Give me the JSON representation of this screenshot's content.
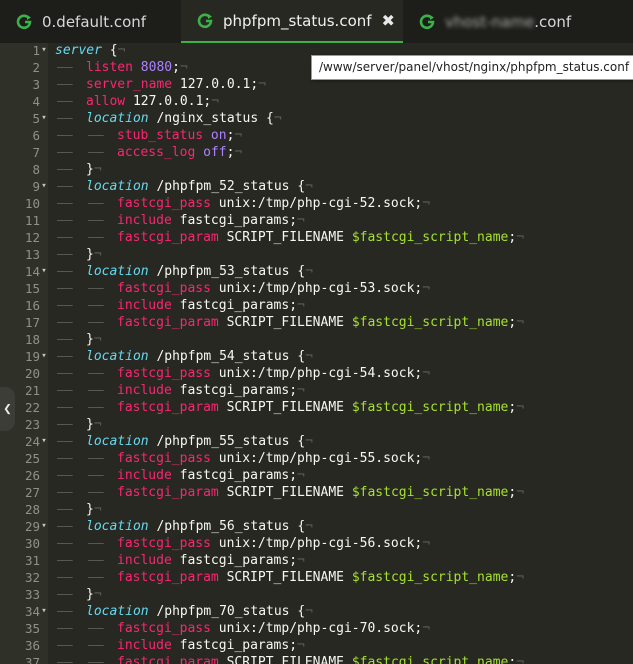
{
  "tabs": [
    {
      "label": "0.default.conf",
      "active": false,
      "icon": "refresh-g-icon"
    },
    {
      "label": "phpfpm_status.conf",
      "active": true,
      "icon": "refresh-g-icon",
      "close": "✖"
    },
    {
      "label_blurred": "vhost-name",
      "label_suffix": ".conf",
      "active": false,
      "icon": "refresh-g-icon"
    }
  ],
  "tooltip": "/www/server/panel/vhost/nginx/phpfpm_status.conf",
  "colors": {
    "bg": "#272822",
    "gutter": "#2f3129",
    "keyword": "#66d9ef",
    "directive": "#f92672",
    "number": "#ae81ff",
    "variable": "#a6e22e",
    "tab_accent": "#3bb14a"
  },
  "code": [
    {
      "n": "1",
      "fold": true,
      "seg": [
        [
          "k",
          "server"
        ],
        [
          "pl",
          " {"
        ]
      ]
    },
    {
      "n": "2",
      "ind": 1,
      "seg": [
        [
          "d",
          "listen"
        ],
        [
          "pl",
          " "
        ],
        [
          "n",
          "8080"
        ],
        [
          "pl",
          ";"
        ]
      ]
    },
    {
      "n": "3",
      "ind": 1,
      "seg": [
        [
          "d",
          "server_name"
        ],
        [
          "pl",
          " 127.0.0.1;"
        ]
      ]
    },
    {
      "n": "4",
      "ind": 1,
      "seg": [
        [
          "d",
          "allow"
        ],
        [
          "pl",
          " 127.0.0.1;"
        ]
      ]
    },
    {
      "n": "5",
      "ind": 1,
      "fold": true,
      "seg": [
        [
          "k",
          "location"
        ],
        [
          "pl",
          " /nginx_status {"
        ]
      ]
    },
    {
      "n": "6",
      "ind": 2,
      "seg": [
        [
          "d",
          "stub_status"
        ],
        [
          "pl",
          " "
        ],
        [
          "n",
          "on"
        ],
        [
          "pl",
          ";"
        ]
      ]
    },
    {
      "n": "7",
      "ind": 2,
      "seg": [
        [
          "d",
          "access_log"
        ],
        [
          "pl",
          " "
        ],
        [
          "n",
          "off"
        ],
        [
          "pl",
          ";"
        ]
      ]
    },
    {
      "n": "8",
      "ind": 1,
      "seg": [
        [
          "pl",
          "}"
        ]
      ]
    },
    {
      "n": "9",
      "ind": 1,
      "fold": true,
      "seg": [
        [
          "k",
          "location"
        ],
        [
          "pl",
          " /phpfpm_52_status {"
        ]
      ]
    },
    {
      "n": "10",
      "ind": 2,
      "seg": [
        [
          "d",
          "fastcgi_pass"
        ],
        [
          "pl",
          " unix:/tmp/php-cgi-52.sock;"
        ]
      ]
    },
    {
      "n": "11",
      "ind": 2,
      "seg": [
        [
          "d",
          "include"
        ],
        [
          "pl",
          " fastcgi_params;"
        ]
      ]
    },
    {
      "n": "12",
      "ind": 2,
      "seg": [
        [
          "d",
          "fastcgi_param"
        ],
        [
          "pl",
          " SCRIPT_FILENAME "
        ],
        [
          "v",
          "$fastcgi_script_name"
        ],
        [
          "pl",
          ";"
        ]
      ]
    },
    {
      "n": "13",
      "ind": 1,
      "seg": [
        [
          "pl",
          "}"
        ]
      ]
    },
    {
      "n": "14",
      "ind": 1,
      "fold": true,
      "seg": [
        [
          "k",
          "location"
        ],
        [
          "pl",
          " /phpfpm_53_status {"
        ]
      ]
    },
    {
      "n": "15",
      "ind": 2,
      "seg": [
        [
          "d",
          "fastcgi_pass"
        ],
        [
          "pl",
          " unix:/tmp/php-cgi-53.sock;"
        ]
      ]
    },
    {
      "n": "16",
      "ind": 2,
      "seg": [
        [
          "d",
          "include"
        ],
        [
          "pl",
          " fastcgi_params;"
        ]
      ]
    },
    {
      "n": "17",
      "ind": 2,
      "seg": [
        [
          "d",
          "fastcgi_param"
        ],
        [
          "pl",
          " SCRIPT_FILENAME "
        ],
        [
          "v",
          "$fastcgi_script_name"
        ],
        [
          "pl",
          ";"
        ]
      ]
    },
    {
      "n": "18",
      "ind": 1,
      "seg": [
        [
          "pl",
          "}"
        ]
      ]
    },
    {
      "n": "19",
      "ind": 1,
      "fold": true,
      "seg": [
        [
          "k",
          "location"
        ],
        [
          "pl",
          " /phpfpm_54_status {"
        ]
      ]
    },
    {
      "n": "20",
      "ind": 2,
      "seg": [
        [
          "d",
          "fastcgi_pass"
        ],
        [
          "pl",
          " unix:/tmp/php-cgi-54.sock;"
        ]
      ]
    },
    {
      "n": "21",
      "ind": 2,
      "seg": [
        [
          "d",
          "include"
        ],
        [
          "pl",
          " fastcgi_params;"
        ]
      ]
    },
    {
      "n": "22",
      "ind": 2,
      "seg": [
        [
          "d",
          "fastcgi_param"
        ],
        [
          "pl",
          " SCRIPT_FILENAME "
        ],
        [
          "v",
          "$fastcgi_script_name"
        ],
        [
          "pl",
          ";"
        ]
      ]
    },
    {
      "n": "23",
      "ind": 1,
      "seg": [
        [
          "pl",
          "}"
        ]
      ]
    },
    {
      "n": "24",
      "ind": 1,
      "fold": true,
      "seg": [
        [
          "k",
          "location"
        ],
        [
          "pl",
          " /phpfpm_55_status {"
        ]
      ]
    },
    {
      "n": "25",
      "ind": 2,
      "seg": [
        [
          "d",
          "fastcgi_pass"
        ],
        [
          "pl",
          " unix:/tmp/php-cgi-55.sock;"
        ]
      ]
    },
    {
      "n": "26",
      "ind": 2,
      "seg": [
        [
          "d",
          "include"
        ],
        [
          "pl",
          " fastcgi_params;"
        ]
      ]
    },
    {
      "n": "27",
      "ind": 2,
      "seg": [
        [
          "d",
          "fastcgi_param"
        ],
        [
          "pl",
          " SCRIPT_FILENAME "
        ],
        [
          "v",
          "$fastcgi_script_name"
        ],
        [
          "pl",
          ";"
        ]
      ]
    },
    {
      "n": "28",
      "ind": 1,
      "seg": [
        [
          "pl",
          "}"
        ]
      ]
    },
    {
      "n": "29",
      "ind": 1,
      "fold": true,
      "seg": [
        [
          "k",
          "location"
        ],
        [
          "pl",
          " /phpfpm_56_status {"
        ]
      ]
    },
    {
      "n": "30",
      "ind": 2,
      "seg": [
        [
          "d",
          "fastcgi_pass"
        ],
        [
          "pl",
          " unix:/tmp/php-cgi-56.sock;"
        ]
      ]
    },
    {
      "n": "31",
      "ind": 2,
      "seg": [
        [
          "d",
          "include"
        ],
        [
          "pl",
          " fastcgi_params;"
        ]
      ]
    },
    {
      "n": "32",
      "ind": 2,
      "seg": [
        [
          "d",
          "fastcgi_param"
        ],
        [
          "pl",
          " SCRIPT_FILENAME "
        ],
        [
          "v",
          "$fastcgi_script_name"
        ],
        [
          "pl",
          ";"
        ]
      ]
    },
    {
      "n": "33",
      "ind": 1,
      "seg": [
        [
          "pl",
          "}"
        ]
      ]
    },
    {
      "n": "34",
      "ind": 1,
      "fold": true,
      "seg": [
        [
          "k",
          "location"
        ],
        [
          "pl",
          " /phpfpm_70_status {"
        ]
      ]
    },
    {
      "n": "35",
      "ind": 2,
      "seg": [
        [
          "d",
          "fastcgi_pass"
        ],
        [
          "pl",
          " unix:/tmp/php-cgi-70.sock;"
        ]
      ]
    },
    {
      "n": "36",
      "ind": 2,
      "seg": [
        [
          "d",
          "include"
        ],
        [
          "pl",
          " fastcgi_params;"
        ]
      ]
    },
    {
      "n": "37",
      "ind": 2,
      "seg": [
        [
          "d",
          "fastcgi_param"
        ],
        [
          "pl",
          " SCRIPT_FILENAME "
        ],
        [
          "v",
          "$fastcgi_script_name"
        ],
        [
          "pl",
          ";"
        ]
      ]
    }
  ]
}
